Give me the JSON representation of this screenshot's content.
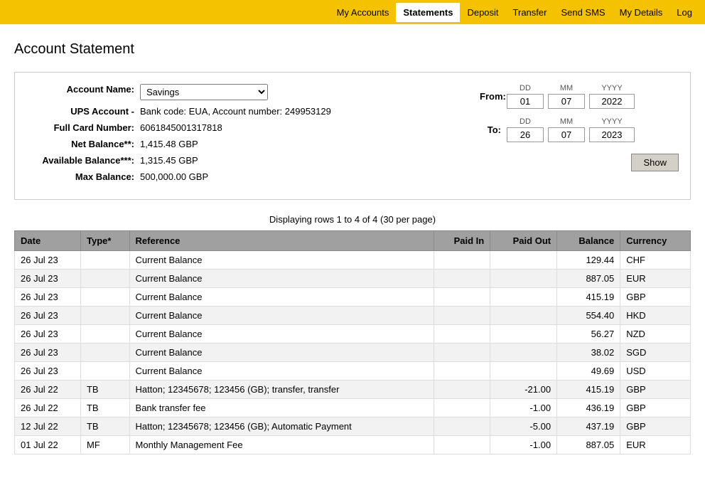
{
  "nav": {
    "items": [
      {
        "label": "My Accounts",
        "active": false
      },
      {
        "label": "Statements",
        "active": true
      },
      {
        "label": "Deposit",
        "active": false
      },
      {
        "label": "Transfer",
        "active": false
      },
      {
        "label": "Send SMS",
        "active": false
      },
      {
        "label": "My Details",
        "active": false
      },
      {
        "label": "Log",
        "active": false
      }
    ]
  },
  "page": {
    "title": "Account Statement"
  },
  "account": {
    "name_label": "Account Name:",
    "name_value": "Savings",
    "ups_label": "UPS Account -",
    "ups_value": "Bank code: EUA, Account number: 249953129",
    "card_label": "Full Card Number:",
    "card_value": "6061845001317818",
    "net_balance_label": "Net Balance**:",
    "net_balance_value": "1,415.48  GBP",
    "avail_balance_label": "Available Balance***:",
    "avail_balance_value": "1,315.45 GBP",
    "max_balance_label": "Max Balance:",
    "max_balance_value": "500,000.00  GBP"
  },
  "date_range": {
    "from_label": "From:",
    "to_label": "To:",
    "from_dd": "01",
    "from_mm": "07",
    "from_yyyy": "2022",
    "to_dd": "26",
    "to_mm": "07",
    "to_yyyy": "2023",
    "dd_header": "DD",
    "mm_header": "MM",
    "yyyy_header": "YYYY",
    "show_label": "Show"
  },
  "table": {
    "pagination": "Displaying rows 1 to 4 of 4 (30 per page)",
    "headers": [
      "Date",
      "Type*",
      "Reference",
      "Paid In",
      "Paid Out",
      "Balance",
      "Currency"
    ],
    "rows": [
      {
        "date": "26 Jul 23",
        "type": "",
        "reference": "Current Balance",
        "paid_in": "",
        "paid_out": "",
        "balance": "129.44",
        "currency": "CHF"
      },
      {
        "date": "26 Jul 23",
        "type": "",
        "reference": "Current Balance",
        "paid_in": "",
        "paid_out": "",
        "balance": "887.05",
        "currency": "EUR"
      },
      {
        "date": "26 Jul 23",
        "type": "",
        "reference": "Current Balance",
        "paid_in": "",
        "paid_out": "",
        "balance": "415.19",
        "currency": "GBP"
      },
      {
        "date": "26 Jul 23",
        "type": "",
        "reference": "Current Balance",
        "paid_in": "",
        "paid_out": "",
        "balance": "554.40",
        "currency": "HKD"
      },
      {
        "date": "26 Jul 23",
        "type": "",
        "reference": "Current Balance",
        "paid_in": "",
        "paid_out": "",
        "balance": "56.27",
        "currency": "NZD"
      },
      {
        "date": "26 Jul 23",
        "type": "",
        "reference": "Current Balance",
        "paid_in": "",
        "paid_out": "",
        "balance": "38.02",
        "currency": "SGD"
      },
      {
        "date": "26 Jul 23",
        "type": "",
        "reference": "Current Balance",
        "paid_in": "",
        "paid_out": "",
        "balance": "49.69",
        "currency": "USD"
      },
      {
        "date": "26 Jul 22",
        "type": "TB",
        "reference": "Hatton; 12345678; 123456 (GB); transfer, transfer",
        "paid_in": "",
        "paid_out": "-21.00",
        "balance": "415.19",
        "currency": "GBP"
      },
      {
        "date": "26 Jul 22",
        "type": "TB",
        "reference": "Bank transfer fee",
        "paid_in": "",
        "paid_out": "-1.00",
        "balance": "436.19",
        "currency": "GBP"
      },
      {
        "date": "12 Jul 22",
        "type": "TB",
        "reference": "Hatton; 12345678; 123456 (GB); Automatic Payment",
        "paid_in": "",
        "paid_out": "-5.00",
        "balance": "437.19",
        "currency": "GBP"
      },
      {
        "date": "01 Jul 22",
        "type": "MF",
        "reference": "Monthly Management Fee",
        "paid_in": "",
        "paid_out": "-1.00",
        "balance": "887.05",
        "currency": "EUR"
      }
    ]
  }
}
